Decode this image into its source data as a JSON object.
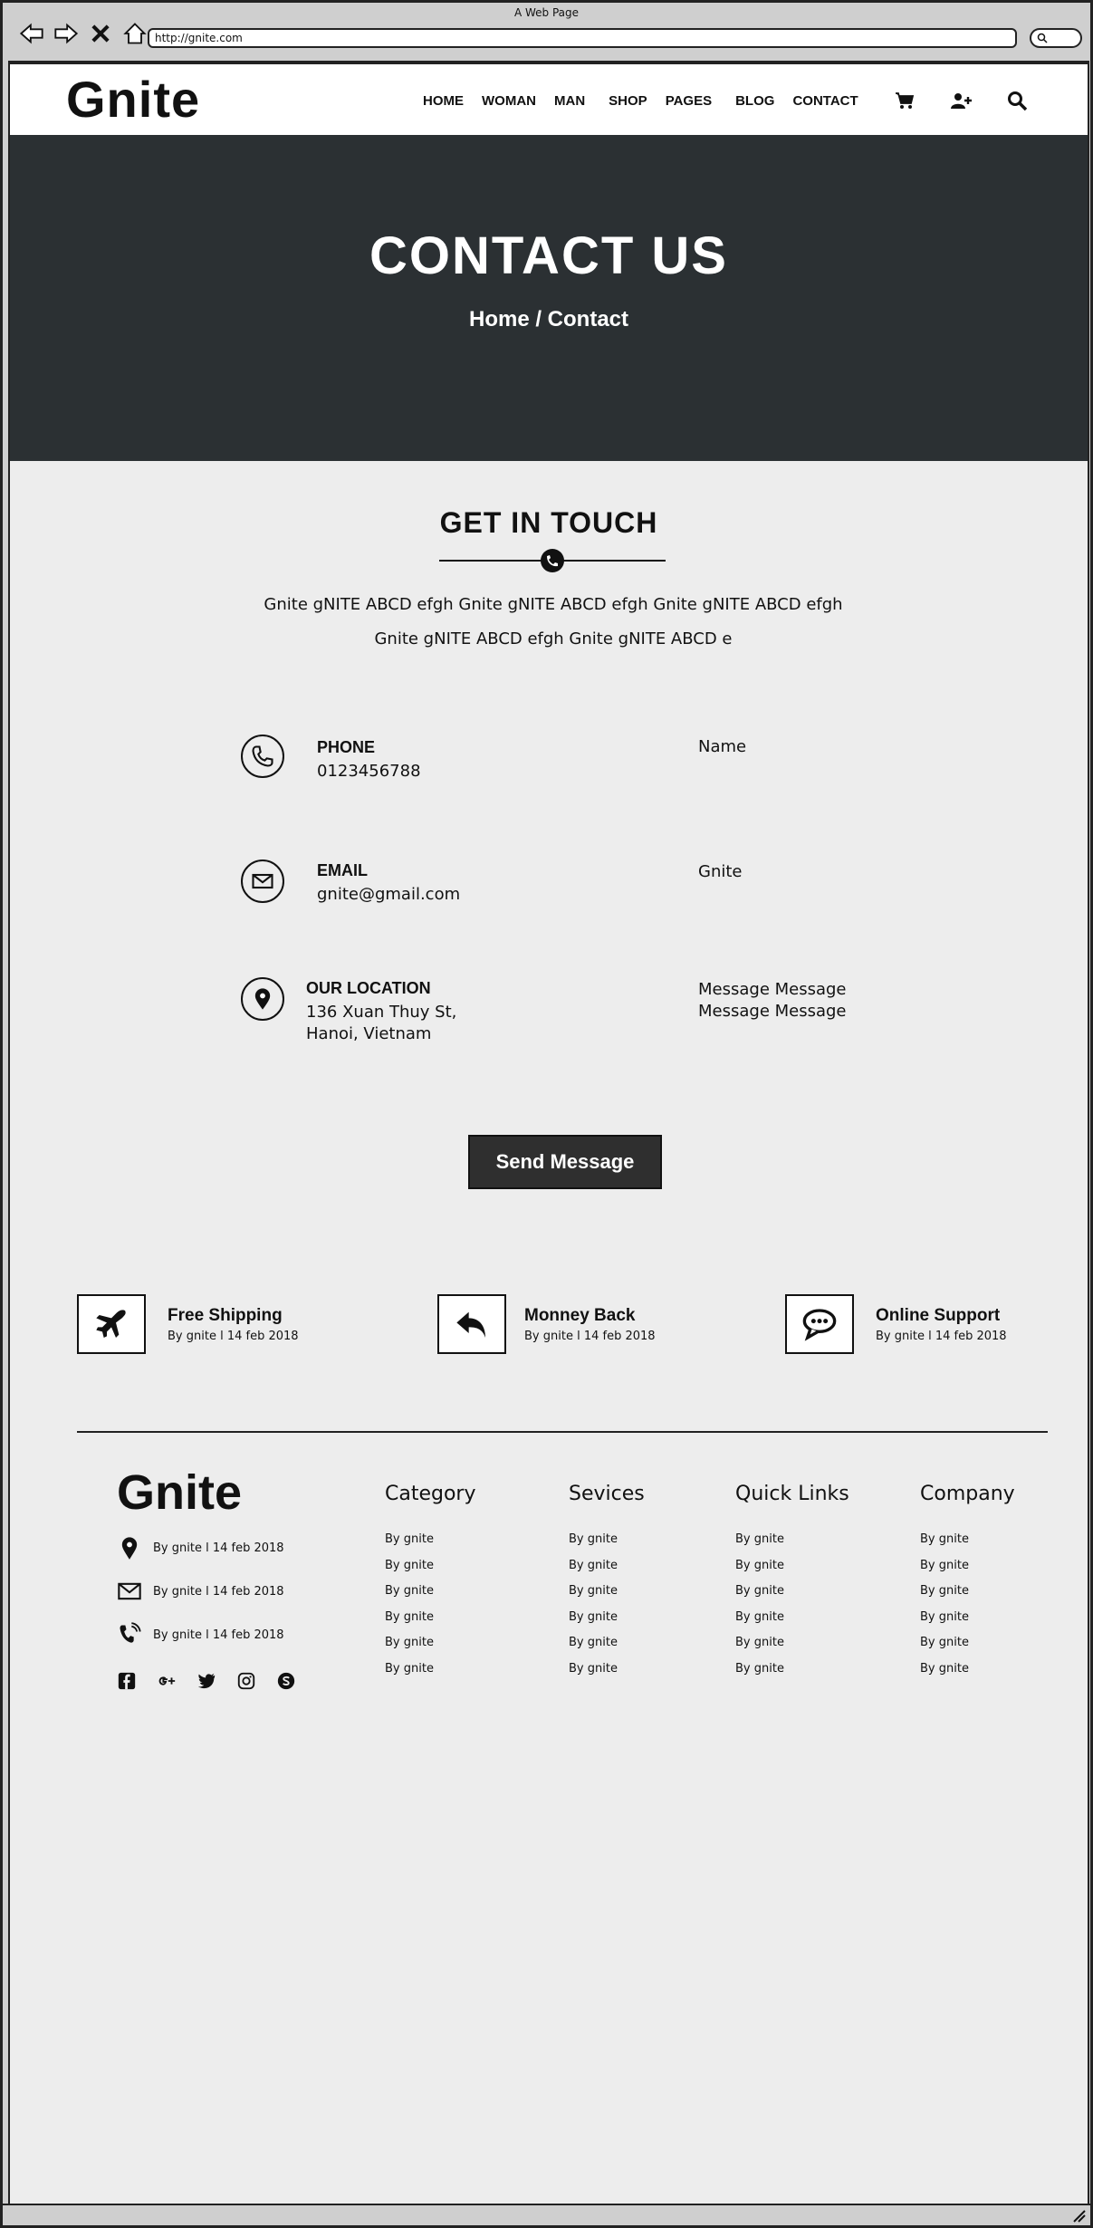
{
  "window": {
    "title": "A Web Page",
    "url": "http://gnite.com"
  },
  "nav": {
    "logo": "Gnite",
    "items": [
      "HOME",
      "WOMAN",
      "MAN",
      "SHOP",
      "PAGES",
      "BLOG",
      "CONTACT"
    ]
  },
  "hero": {
    "title": "CONTACT US",
    "breadcrumb": "Home / Contact"
  },
  "touch": {
    "title": "GET IN TOUCH",
    "desc_line1": "Gnite gNITE ABCD efgh Gnite gNITE ABCD efgh Gnite gNITE ABCD efgh",
    "desc_line2": "Gnite gNITE ABCD efgh Gnite gNITE ABCD e"
  },
  "info": {
    "phone_label": "PHONE",
    "phone_value": "0123456788",
    "email_label": "EMAIL",
    "email_value": "gnite@gmail.com",
    "location_label": "OUR LOCATION",
    "location_line1": "136 Xuan Thuy St,",
    "location_line2": "Hanoi, Vietnam"
  },
  "form": {
    "name": "Name",
    "company": "Gnite",
    "message_line1": "Message Message",
    "message_line2": "Message Message",
    "send": "Send Message"
  },
  "features": [
    {
      "title": "Free Shipping",
      "sub": "By gnite l 14 feb 2018",
      "icon": "airplane-icon"
    },
    {
      "title": "Monney Back",
      "sub": "By gnite l 14 feb 2018",
      "icon": "reply-icon"
    },
    {
      "title": "Online Support",
      "sub": "By gnite l 14 feb 2018",
      "icon": "chat-icon"
    }
  ],
  "footer": {
    "logo": "Gnite",
    "contacts": [
      "By gnite l 14 feb 2018",
      "By gnite l 14 feb 2018",
      "By gnite l 14 feb 2018"
    ],
    "columns": [
      {
        "heading": "Category",
        "links": [
          "By gnite",
          "By gnite",
          "By gnite",
          "By gnite",
          "By gnite",
          "By gnite"
        ]
      },
      {
        "heading": "Sevices",
        "links": [
          "By gnite",
          "By gnite",
          "By gnite",
          "By gnite",
          "By gnite",
          "By gnite"
        ]
      },
      {
        "heading": "Quick Links",
        "links": [
          "By gnite",
          "By gnite",
          "By gnite",
          "By gnite",
          "By gnite",
          "By gnite"
        ]
      },
      {
        "heading": "Company",
        "links": [
          "By gnite",
          "By gnite",
          "By gnite",
          "By gnite",
          "By gnite",
          "By gnite"
        ]
      }
    ]
  }
}
